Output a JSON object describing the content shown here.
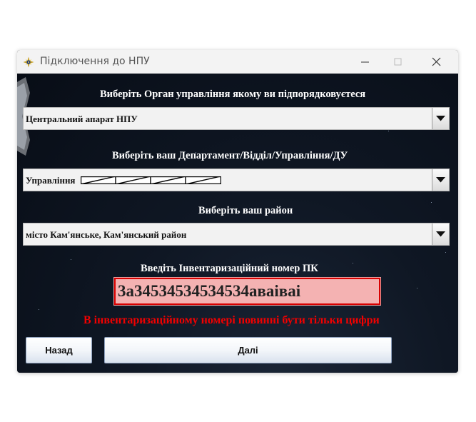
{
  "window": {
    "title": "Підключення до НПУ",
    "app_icon": "police-emblem-icon",
    "controls": [
      "minimize-icon",
      "maximize-icon",
      "close-icon"
    ]
  },
  "form": {
    "organ": {
      "label": "Виберіть Орган управління якому ви підпорядковуєтеся",
      "value": "Центральний апарат НПУ"
    },
    "department": {
      "label": "Виберіть ваш Департамент/Відділ/Управління/ДУ",
      "value": "Управління"
    },
    "district": {
      "label": "Виберіть ваш район",
      "value": "місто Кам'янське, Кам'янський район"
    },
    "inventory": {
      "label": "Введіть Інвентаризаційний номер ПК",
      "value": "3а34534534534534аваіваі"
    },
    "error": "В інвентаризаційному номері повинні бути тільки цифри"
  },
  "buttons": {
    "back": "Назад",
    "next": "Далі"
  },
  "colors": {
    "background": "#0b1220",
    "error_text": "#f20000",
    "input_error_bg": "#f4b2b2",
    "input_error_border": "#d80000"
  }
}
